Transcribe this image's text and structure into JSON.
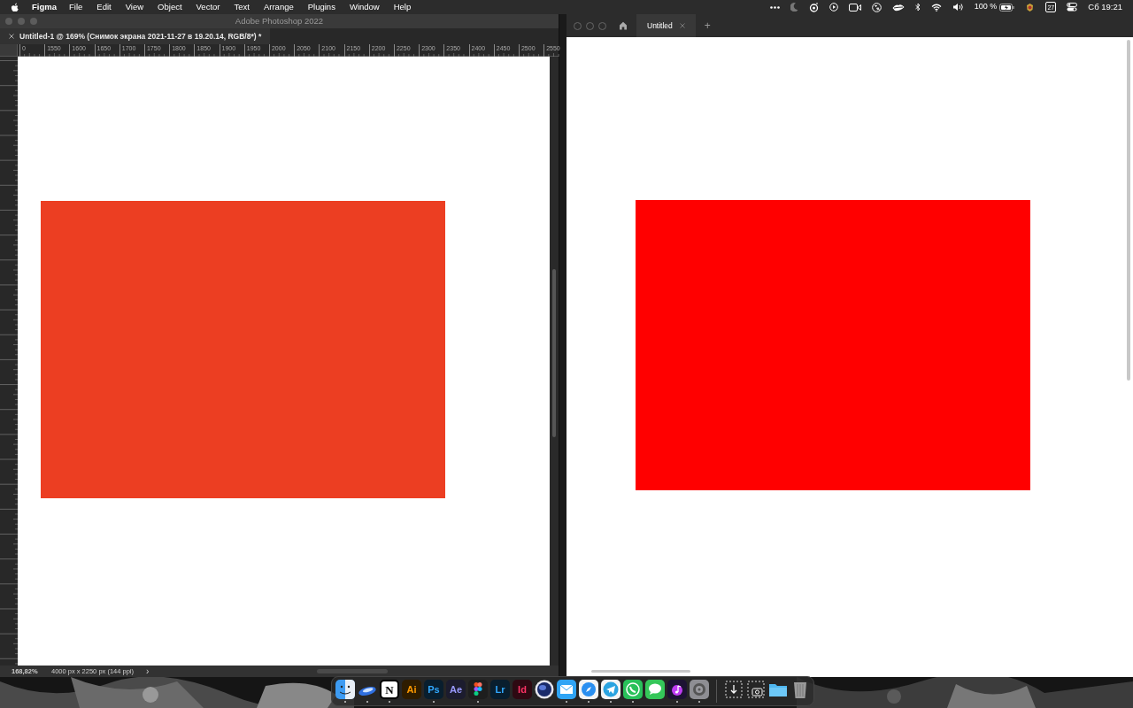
{
  "menu_bar": {
    "app": "Figma",
    "items": [
      "File",
      "Edit",
      "View",
      "Object",
      "Vector",
      "Text",
      "Arrange",
      "Plugins",
      "Window",
      "Help"
    ],
    "battery": "100 %",
    "calendar_day": "27",
    "clock": "Сб 19:21"
  },
  "photoshop": {
    "title": "Adobe Photoshop 2022",
    "tab": "Untitled-1 @ 169% (Снимок экрана 2021-11-27 в 19.20.14, RGB/8*) *",
    "ruler_labels": [
      "0",
      "1550",
      "1600",
      "1650",
      "1700",
      "1750",
      "1800",
      "1850",
      "1900",
      "1950",
      "2000",
      "2050",
      "2100",
      "2150",
      "2200",
      "2250",
      "2300",
      "2350",
      "2400",
      "2450",
      "2500",
      "2550"
    ],
    "zoom": "168,82%",
    "doc_info": "4000 px x 2250 px (144 ppi)",
    "status_arrow": "›"
  },
  "figma": {
    "tabs": [
      {
        "label": "Untitled",
        "selected": true
      }
    ],
    "new_tab": "+"
  },
  "dock": [
    {
      "kind": "finder",
      "running": true
    },
    {
      "kind": "swoosh",
      "running": true
    },
    {
      "kind": "notion",
      "glyph": "N",
      "running": true
    },
    {
      "kind": "letter",
      "glyph": "Ai",
      "color": "#ff9a00",
      "running": false
    },
    {
      "kind": "letter",
      "glyph": "Ps",
      "color": "#31a8ff",
      "running": true
    },
    {
      "kind": "letter",
      "glyph": "Ae",
      "color": "#9999ff",
      "running": false
    },
    {
      "kind": "figma",
      "running": true
    },
    {
      "kind": "letter",
      "glyph": "Lr",
      "color": "#31a8ff",
      "running": false
    },
    {
      "kind": "letter",
      "glyph": "Id",
      "color": "#ff3366",
      "running": false
    },
    {
      "kind": "sphere",
      "running": false
    },
    {
      "kind": "mail",
      "running": true
    },
    {
      "kind": "compass",
      "running": true
    },
    {
      "kind": "plane",
      "running": true
    },
    {
      "kind": "phone",
      "running": true
    },
    {
      "kind": "bubble",
      "running": false
    },
    {
      "kind": "note",
      "running": true
    },
    {
      "kind": "gear",
      "running": true
    },
    {
      "kind": "separator"
    },
    {
      "kind": "download",
      "running": false
    },
    {
      "kind": "screenshot",
      "running": false
    },
    {
      "kind": "folder",
      "running": false
    },
    {
      "kind": "trash",
      "running": false
    }
  ]
}
